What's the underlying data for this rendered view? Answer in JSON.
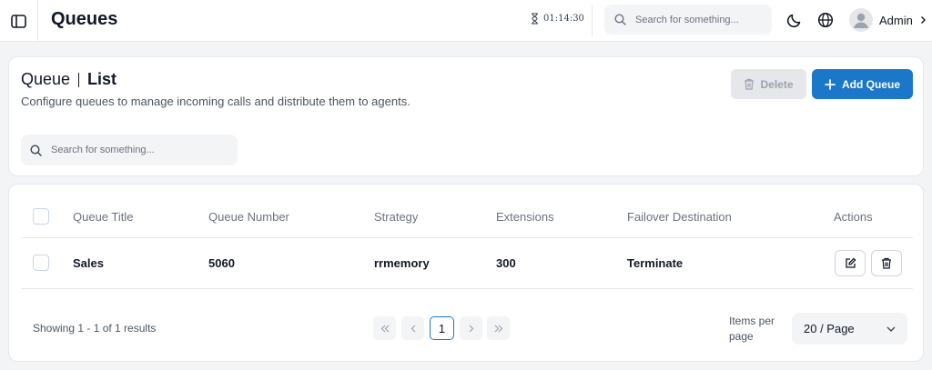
{
  "header": {
    "title": "Queues",
    "timer": "01:14:30",
    "search_placeholder": "Search for something...",
    "user_name": "Admin"
  },
  "section": {
    "title_part1": "Queue",
    "title_part2": "List",
    "description": "Configure queues to manage incoming calls and distribute them to agents.",
    "delete_label": "Delete",
    "add_label": "Add Queue",
    "search_placeholder": "Search for something..."
  },
  "table": {
    "columns": {
      "title": "Queue Title",
      "number": "Queue Number",
      "strategy": "Strategy",
      "extensions": "Extensions",
      "failover": "Failover Destination",
      "actions": "Actions"
    },
    "rows": [
      {
        "title": "Sales",
        "number": "5060",
        "strategy": "rrmemory",
        "extensions": "300",
        "failover": "Terminate"
      }
    ]
  },
  "footer": {
    "showing": "Showing 1 - 1 of 1 results",
    "current_page": "1",
    "items_per_page_label": "Items per page",
    "page_size": "20 / Page"
  },
  "colors": {
    "primary": "#1a77c9",
    "disabled_bg": "#e5e7eb",
    "border": "#e5e7eb"
  }
}
